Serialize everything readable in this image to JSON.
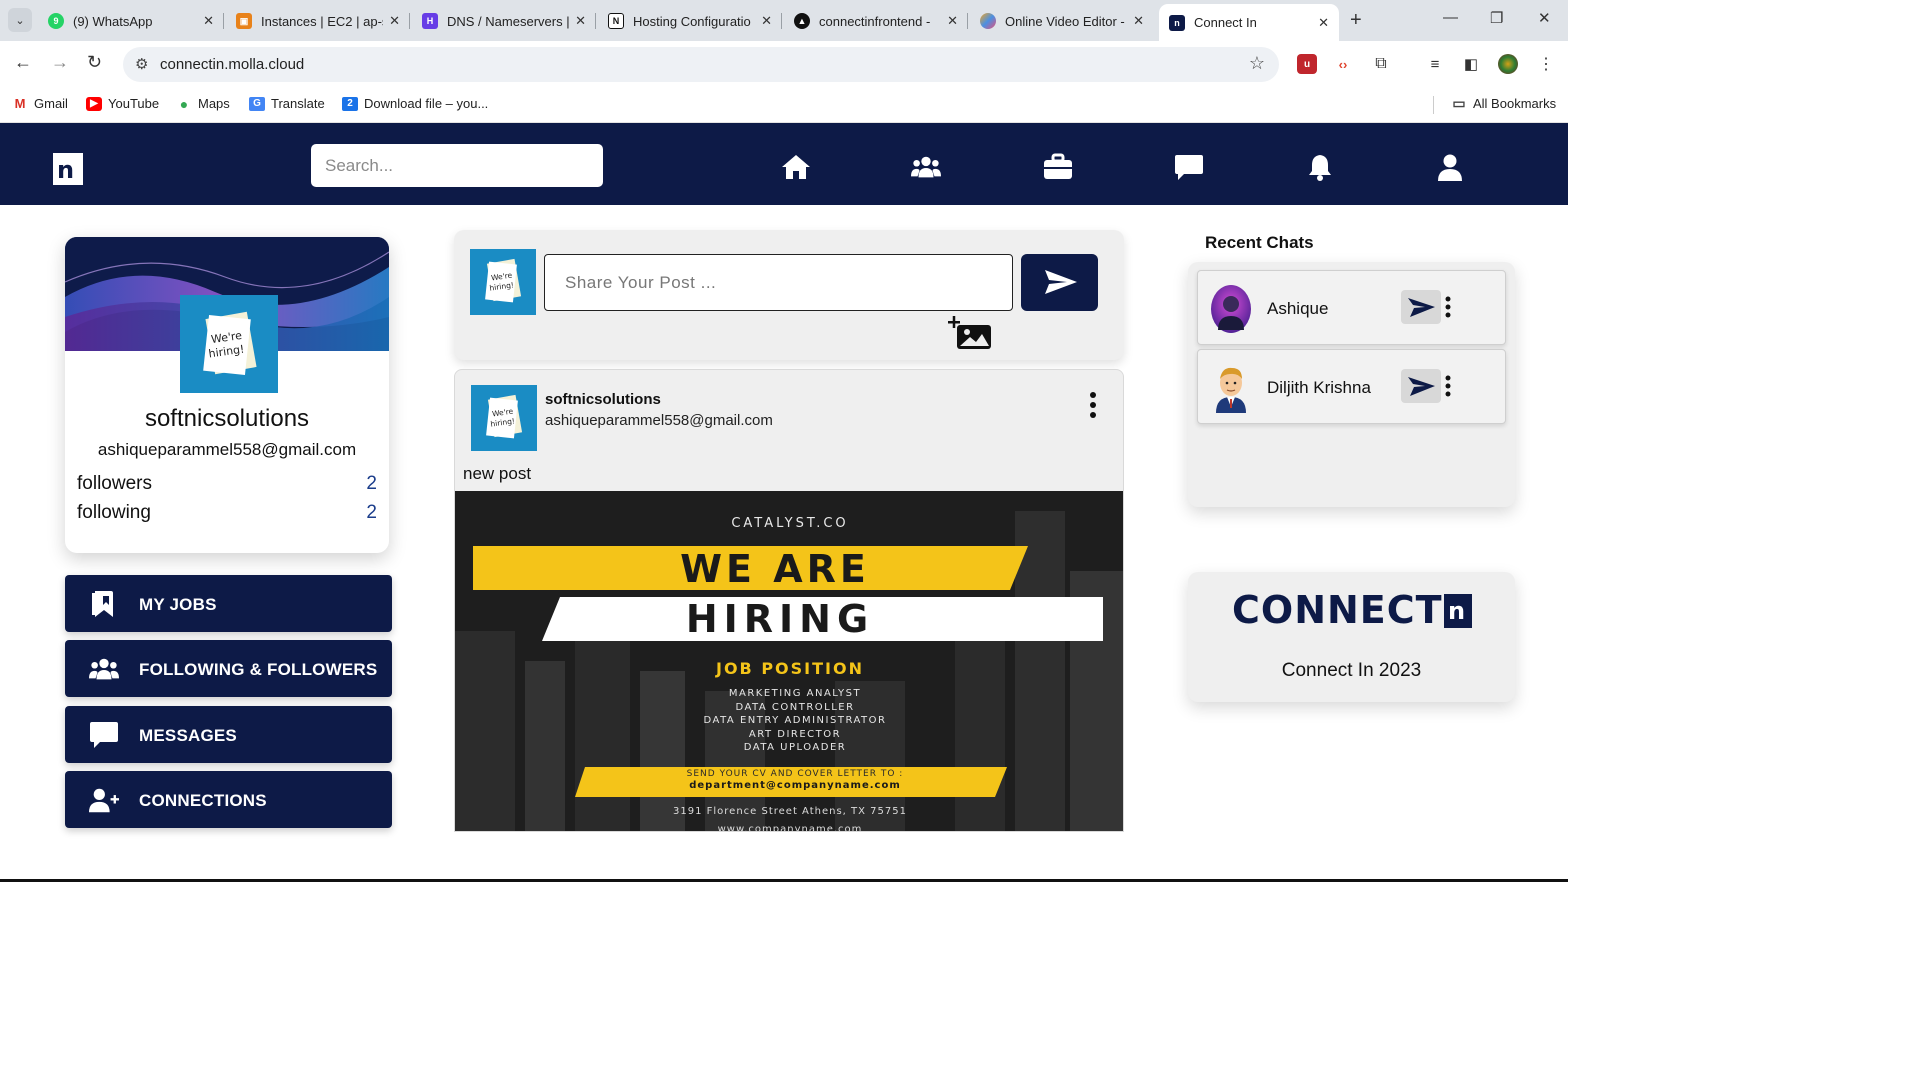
{
  "browser": {
    "tabs": [
      {
        "title": "(9) WhatsApp",
        "icon": "whatsapp-icon",
        "color": "#25d366"
      },
      {
        "title": "Instances | EC2 | ap-s",
        "icon": "aws-icon",
        "color": "#e8821a"
      },
      {
        "title": "DNS / Nameservers |",
        "icon": "hostinger-icon",
        "color": "#673de6"
      },
      {
        "title": "Hosting Configuratio",
        "icon": "notion-icon",
        "color": "#111111"
      },
      {
        "title": "connectinfrontend -",
        "icon": "vercel-icon",
        "color": "#111111"
      },
      {
        "title": "Online Video Editor -",
        "icon": "editor-icon",
        "color": "#4a90e2"
      },
      {
        "title": "Connect In",
        "icon": "connectin-icon",
        "color": "#0d1a47"
      }
    ],
    "url": "connectin.molla.cloud",
    "bookmarks": [
      "Gmail",
      "YouTube",
      "Maps",
      "Translate",
      "Download file – you...",
      "All Bookmarks"
    ]
  },
  "header": {
    "search_placeholder": "Search...",
    "nav_icons": [
      "home-icon",
      "people-icon",
      "briefcase-icon",
      "chat-icon",
      "bell-icon",
      "user-icon"
    ],
    "brand_color": "#0d1a47"
  },
  "profile": {
    "name": "softnicsolutions",
    "email": "ashiqueparammel558@gmail.com",
    "followers_label": "followers",
    "followers": "2",
    "following_label": "following",
    "following": "2"
  },
  "menu": {
    "items": [
      {
        "label": "MY JOBS",
        "icon": "bookmark-icon"
      },
      {
        "label": "FOLLOWING & FOLLOWERS",
        "icon": "users-icon"
      },
      {
        "label": "MESSAGES",
        "icon": "message-icon"
      },
      {
        "label": "CONNECTIONS",
        "icon": "add-user-icon"
      }
    ]
  },
  "composer": {
    "placeholder": "Share Your Post ..."
  },
  "post": {
    "author": "softnicsolutions",
    "email": "ashiqueparammel558@gmail.com",
    "text": "new post",
    "image": {
      "brand": "CATALYST.CO",
      "headline_1": "WE ARE",
      "headline_2": "HIRING",
      "section_title": "JOB POSITION",
      "positions": [
        "MARKETING ANALYST",
        "DATA CONTROLLER",
        "DATA ENTRY ADMINISTRATOR",
        "ART DIRECTOR",
        "DATA UPLOADER"
      ],
      "cta": "SEND YOUR CV AND COVER LETTER TO :",
      "cta_email": "department@companyname.com",
      "address": "3191 Florence Street Athens, TX 75751",
      "website": "www.companyname.com"
    }
  },
  "recent_chats": {
    "title": "Recent Chats",
    "items": [
      {
        "name": "Ashique"
      },
      {
        "name": "Diljith Krishna"
      }
    ]
  },
  "brand_card": {
    "word": "CONNECT",
    "logo_n": "n",
    "subtitle": "Connect In 2023"
  }
}
